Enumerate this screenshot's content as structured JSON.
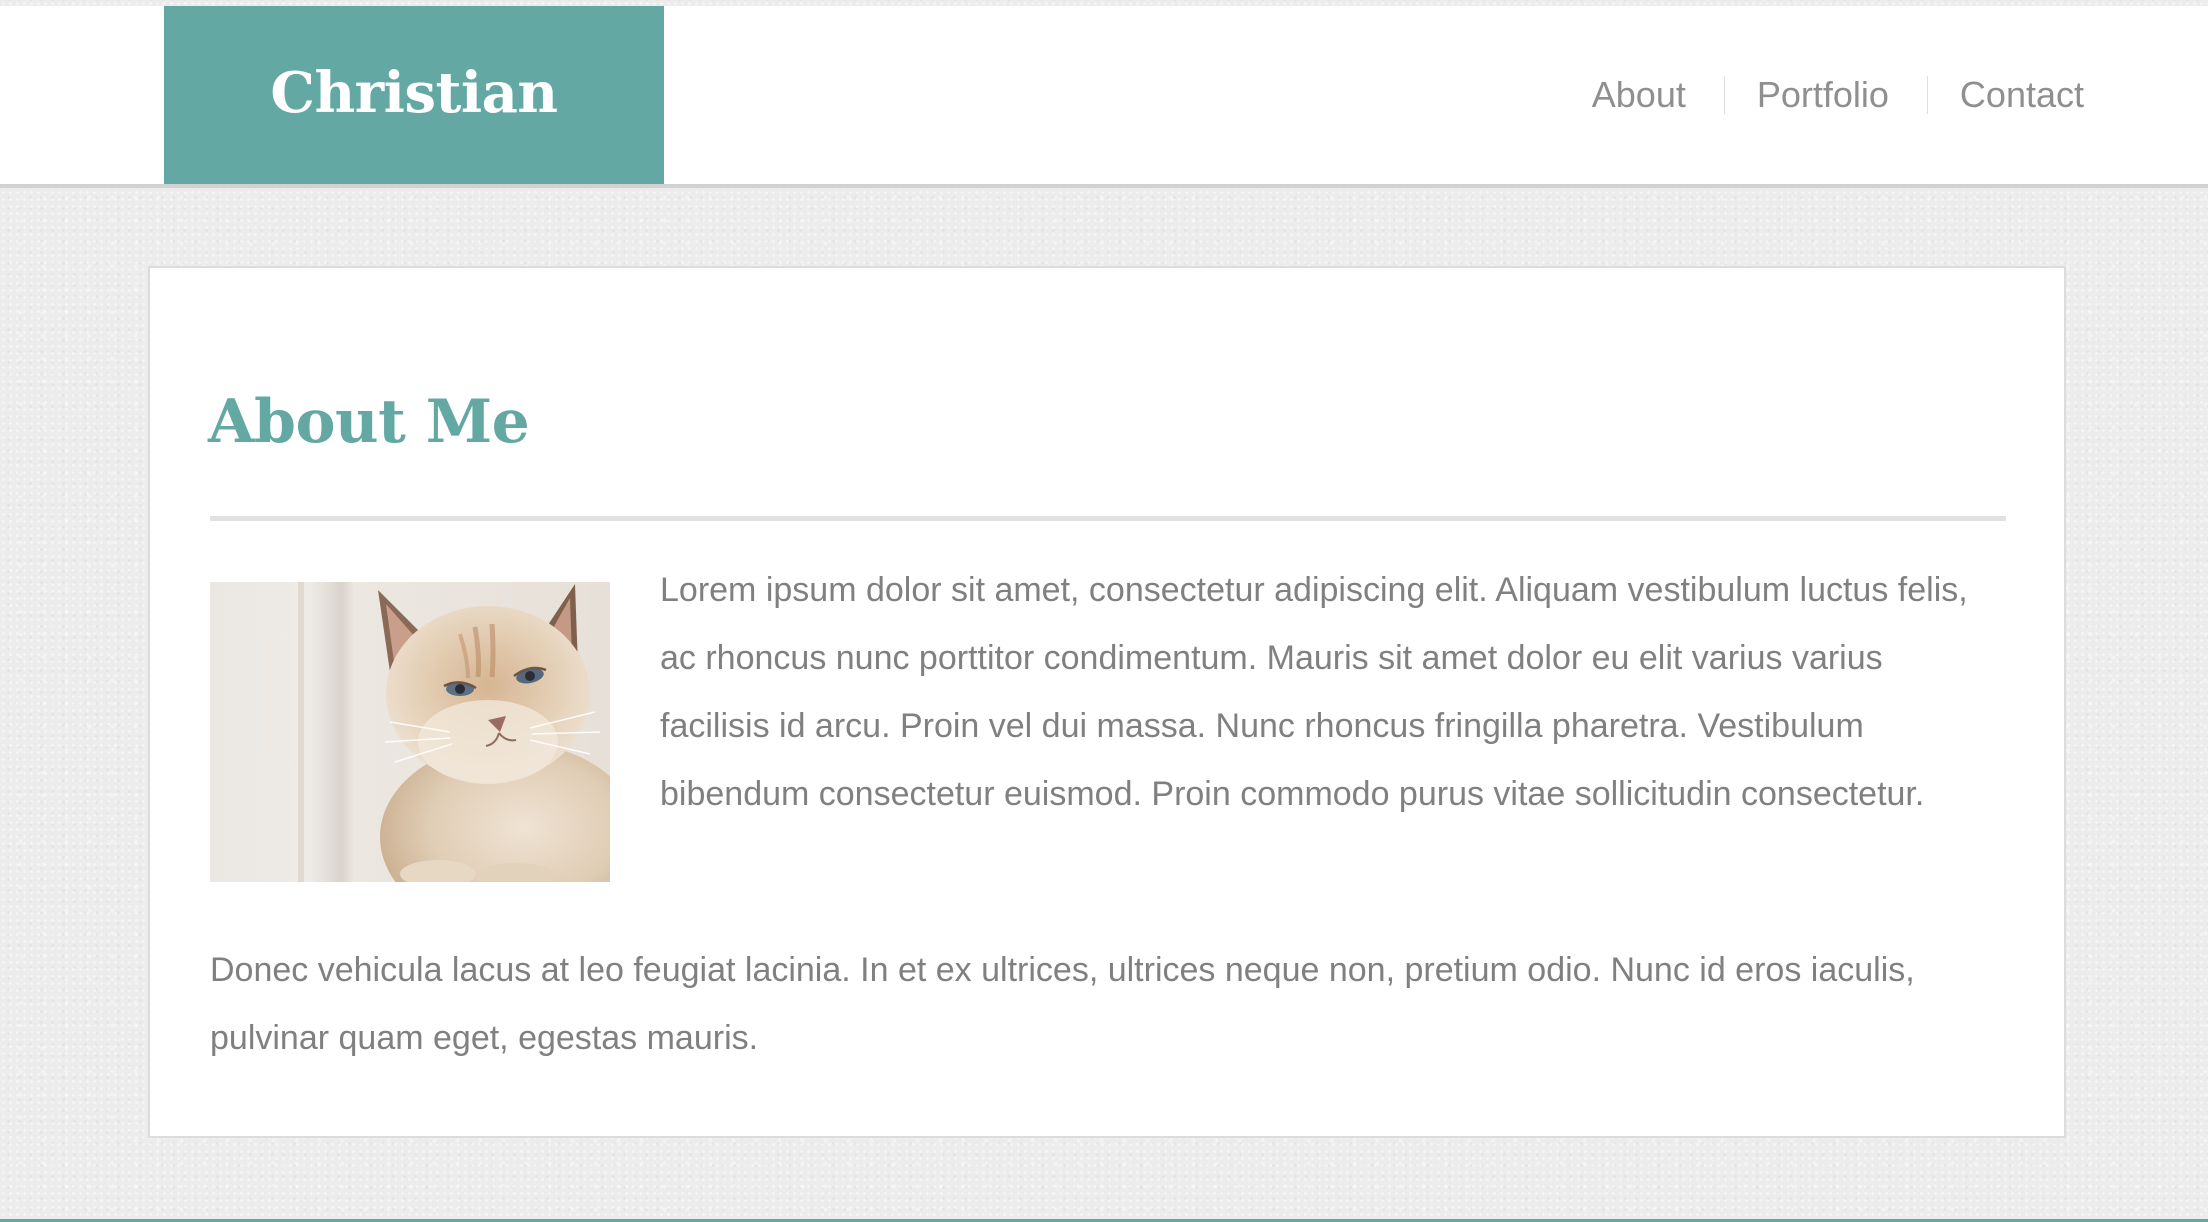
{
  "header": {
    "logo_text": "Christian",
    "nav": [
      {
        "label": "About"
      },
      {
        "label": "Portfolio"
      },
      {
        "label": "Contact"
      }
    ]
  },
  "main": {
    "title": "About Me",
    "image_subject": "cat-photo",
    "paragraph_1": "Lorem ipsum dolor sit amet, consectetur adipiscing elit. Aliquam vestibulum luctus felis, ac rhoncus nunc porttitor condimentum. Mauris sit amet dolor eu elit varius varius facilisis id arcu. Proin vel dui massa. Nunc rhoncus fringilla pharetra. Vestibulum bibendum consectetur euismod. Proin commodo purus vitae sollicitudin consectetur.",
    "paragraph_2": "Donec vehicula lacus at leo feugiat lacinia. In et ex ultrices, ultrices neque non, pretium odio. Nunc id eros iaculis, pulvinar quam eget, egestas mauris."
  },
  "colors": {
    "accent": "#64a8a4",
    "nav_text": "#8f8f8f",
    "body_text": "#808080",
    "page_background": "#ececec"
  }
}
